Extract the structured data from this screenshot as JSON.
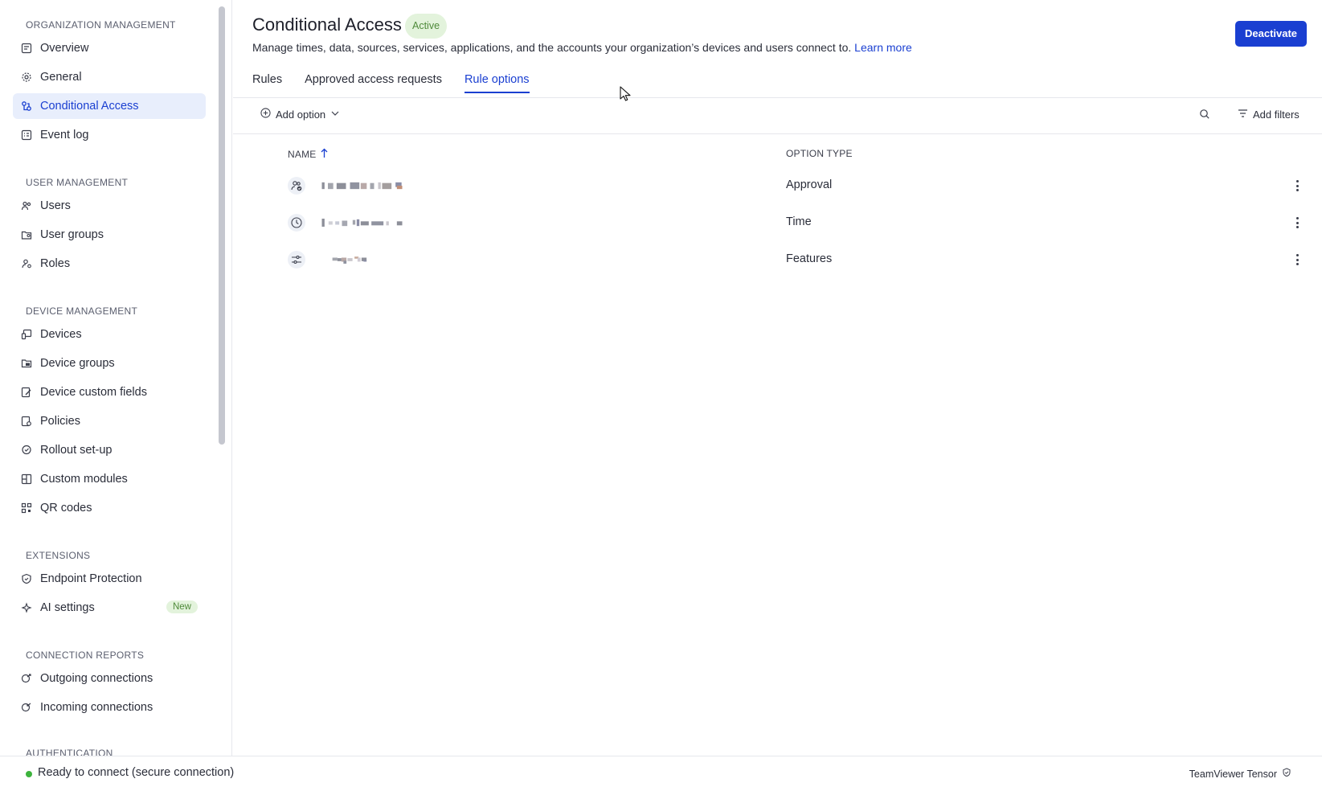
{
  "sidebar": {
    "sections": [
      {
        "header": "ORGANIZATION MANAGEMENT",
        "items": [
          {
            "label": "Overview",
            "icon": "overview-icon"
          },
          {
            "label": "General",
            "icon": "gear-icon"
          },
          {
            "label": "Conditional Access",
            "icon": "conditional-access-icon",
            "active": true
          },
          {
            "label": "Event log",
            "icon": "event-log-icon"
          }
        ]
      },
      {
        "header": "USER MANAGEMENT",
        "items": [
          {
            "label": "Users",
            "icon": "users-icon"
          },
          {
            "label": "User groups",
            "icon": "user-groups-icon"
          },
          {
            "label": "Roles",
            "icon": "roles-icon"
          }
        ]
      },
      {
        "header": "DEVICE MANAGEMENT",
        "items": [
          {
            "label": "Devices",
            "icon": "devices-icon"
          },
          {
            "label": "Device groups",
            "icon": "device-groups-icon"
          },
          {
            "label": "Device custom fields",
            "icon": "custom-fields-icon"
          },
          {
            "label": "Policies",
            "icon": "policies-icon"
          },
          {
            "label": "Rollout set-up",
            "icon": "rollout-icon"
          },
          {
            "label": "Custom modules",
            "icon": "modules-icon"
          },
          {
            "label": "QR codes",
            "icon": "qr-icon"
          }
        ]
      },
      {
        "header": "EXTENSIONS",
        "items": [
          {
            "label": "Endpoint Protection",
            "icon": "shield-icon"
          },
          {
            "label": "AI settings",
            "icon": "sparkle-icon",
            "badge": "New"
          }
        ]
      },
      {
        "header": "CONNECTION REPORTS",
        "items": [
          {
            "label": "Outgoing connections",
            "icon": "outgoing-icon"
          },
          {
            "label": "Incoming connections",
            "icon": "incoming-icon"
          }
        ]
      },
      {
        "header": "AUTHENTICATION",
        "items": []
      }
    ]
  },
  "header": {
    "title": "Conditional Access",
    "status": "Active",
    "description": "Manage times, data, sources, services, applications, and the accounts your organization’s devices and users connect to.",
    "learn_more": "Learn more",
    "deactivate": "Deactivate"
  },
  "tabs": [
    {
      "label": "Rules"
    },
    {
      "label": "Approved access requests"
    },
    {
      "label": "Rule options",
      "active": true
    }
  ],
  "toolbar": {
    "add_option": "Add option",
    "add_filters": "Add filters"
  },
  "table": {
    "columns": [
      "NAME",
      "OPTION TYPE"
    ],
    "rows": [
      {
        "icon": "user-check-icon",
        "type": "Approval"
      },
      {
        "icon": "clock-icon",
        "type": "Time"
      },
      {
        "icon": "sliders-icon",
        "type": "Features"
      }
    ]
  },
  "footer": {
    "status": "Ready to connect (secure connection)",
    "brand": "TeamViewer Tensor"
  },
  "colors": {
    "accent": "#1a3fd1",
    "active_bg": "#e8eefc",
    "badge_green_bg": "#e3f3dc",
    "badge_green_text": "#4f8a3a",
    "status_green": "#3db33d"
  }
}
